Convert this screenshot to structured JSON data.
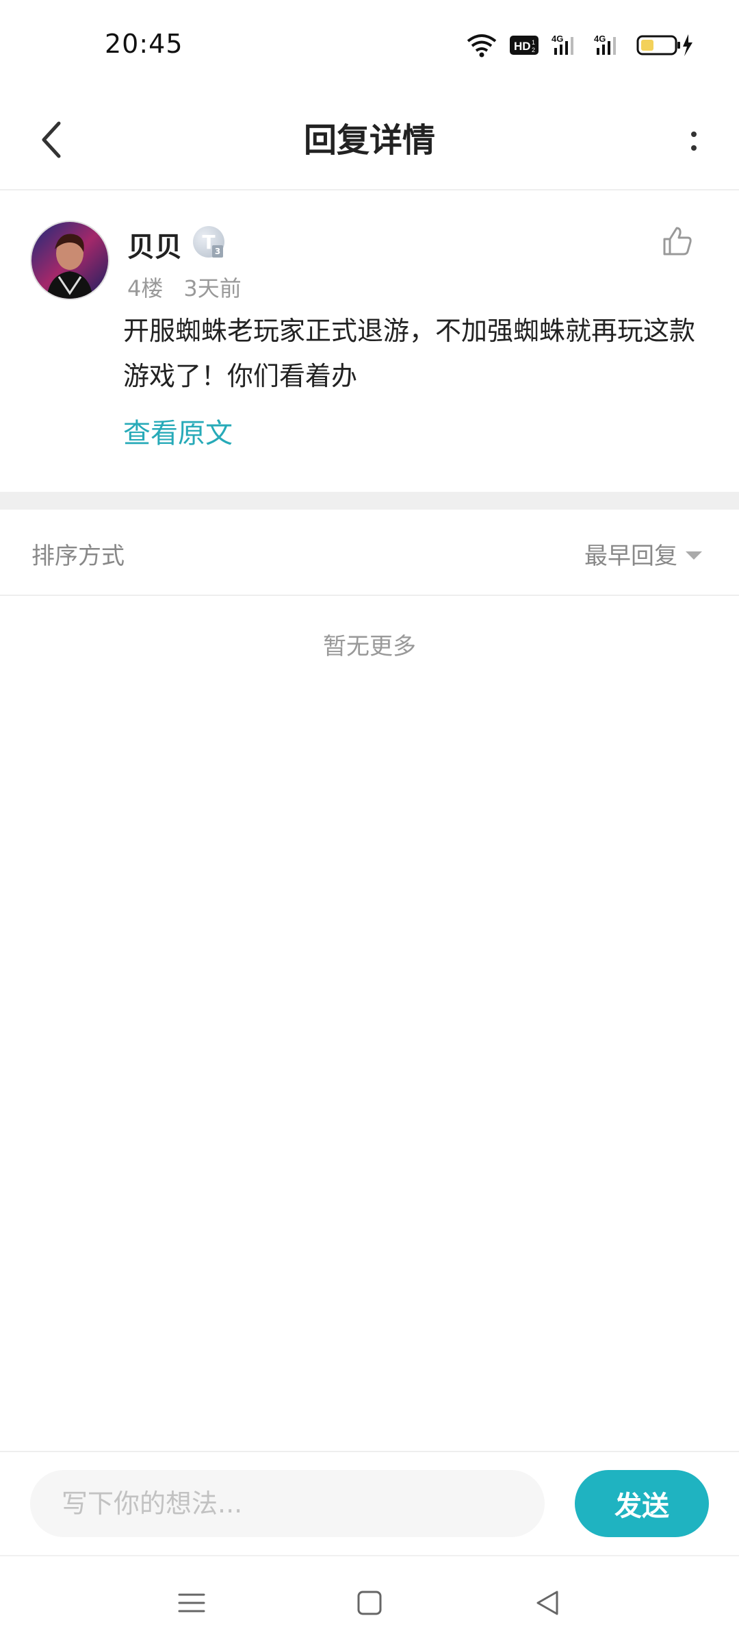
{
  "status_bar": {
    "time": "20:45",
    "icons": [
      "wifi-icon",
      "hd-voice-icon",
      "signal-4g-icon",
      "signal-4g-icon",
      "battery-charging-icon"
    ],
    "hd_label": "HD",
    "net_label": "4G"
  },
  "header": {
    "title": "回复详情",
    "back_icon": "chevron-left-icon",
    "more_icon": "more-vertical-icon"
  },
  "comment": {
    "username": "贝贝",
    "level_badge": "T",
    "level_sub": "3",
    "floor": "4楼",
    "time_ago": "3天前",
    "text": "开服蜘蛛老玩家正式退游，不加强蜘蛛就再玩这款游戏了！你们看着办",
    "view_original": "查看原文",
    "like_icon": "thumbs-up-icon"
  },
  "sort": {
    "label": "排序方式",
    "value": "最早回复"
  },
  "list": {
    "empty_text": "暂无更多"
  },
  "input": {
    "placeholder": "写下你的想法...",
    "value": "",
    "send_label": "发送"
  },
  "colors": {
    "accent": "#1fb3c1",
    "link": "#27aab8",
    "muted": "#999999"
  }
}
